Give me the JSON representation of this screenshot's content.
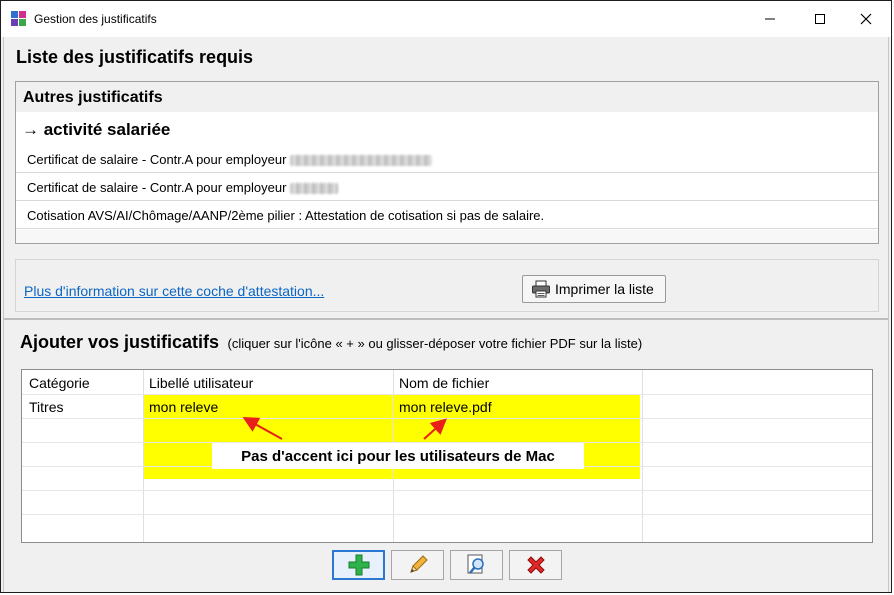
{
  "window": {
    "title": "Gestion des justificatifs",
    "icon": "app-icon"
  },
  "required": {
    "title": "Liste des justificatifs requis",
    "group_header": "Autres justificatifs",
    "category": "→ activité salariée",
    "items": [
      {
        "text": "Certificat de salaire - Contr.A pour employeur"
      },
      {
        "text": "Certificat de salaire - Contr.A pour employeur"
      },
      {
        "text": "Cotisation AVS/AI/Chômage/AANP/2ème pilier : Attestation de cotisation si pas de salaire."
      }
    ],
    "info_link": "Plus d'information sur cette coche d'attestation...",
    "print_label": "Imprimer la liste"
  },
  "add": {
    "title": "Ajouter vos justificatifs",
    "hint": "(cliquer sur l'icône « + » ou glisser-déposer votre fichier PDF sur la liste)",
    "columns": [
      "Catégorie",
      "Libellé utilisateur",
      "Nom de fichier"
    ],
    "rows": [
      {
        "category": "Titres",
        "label": "mon releve",
        "filename": "mon releve.pdf"
      }
    ],
    "annotation": "Pas d'accent ici pour les utilisateurs de Mac",
    "highlight_color": "#ffff00",
    "arrow_color": "#e8201a"
  },
  "toolbar": [
    "add-icon",
    "edit-icon",
    "view-icon",
    "delete-icon"
  ],
  "colors": {
    "link": "#0b66c4",
    "selected_button_border": "#2a78d2"
  }
}
